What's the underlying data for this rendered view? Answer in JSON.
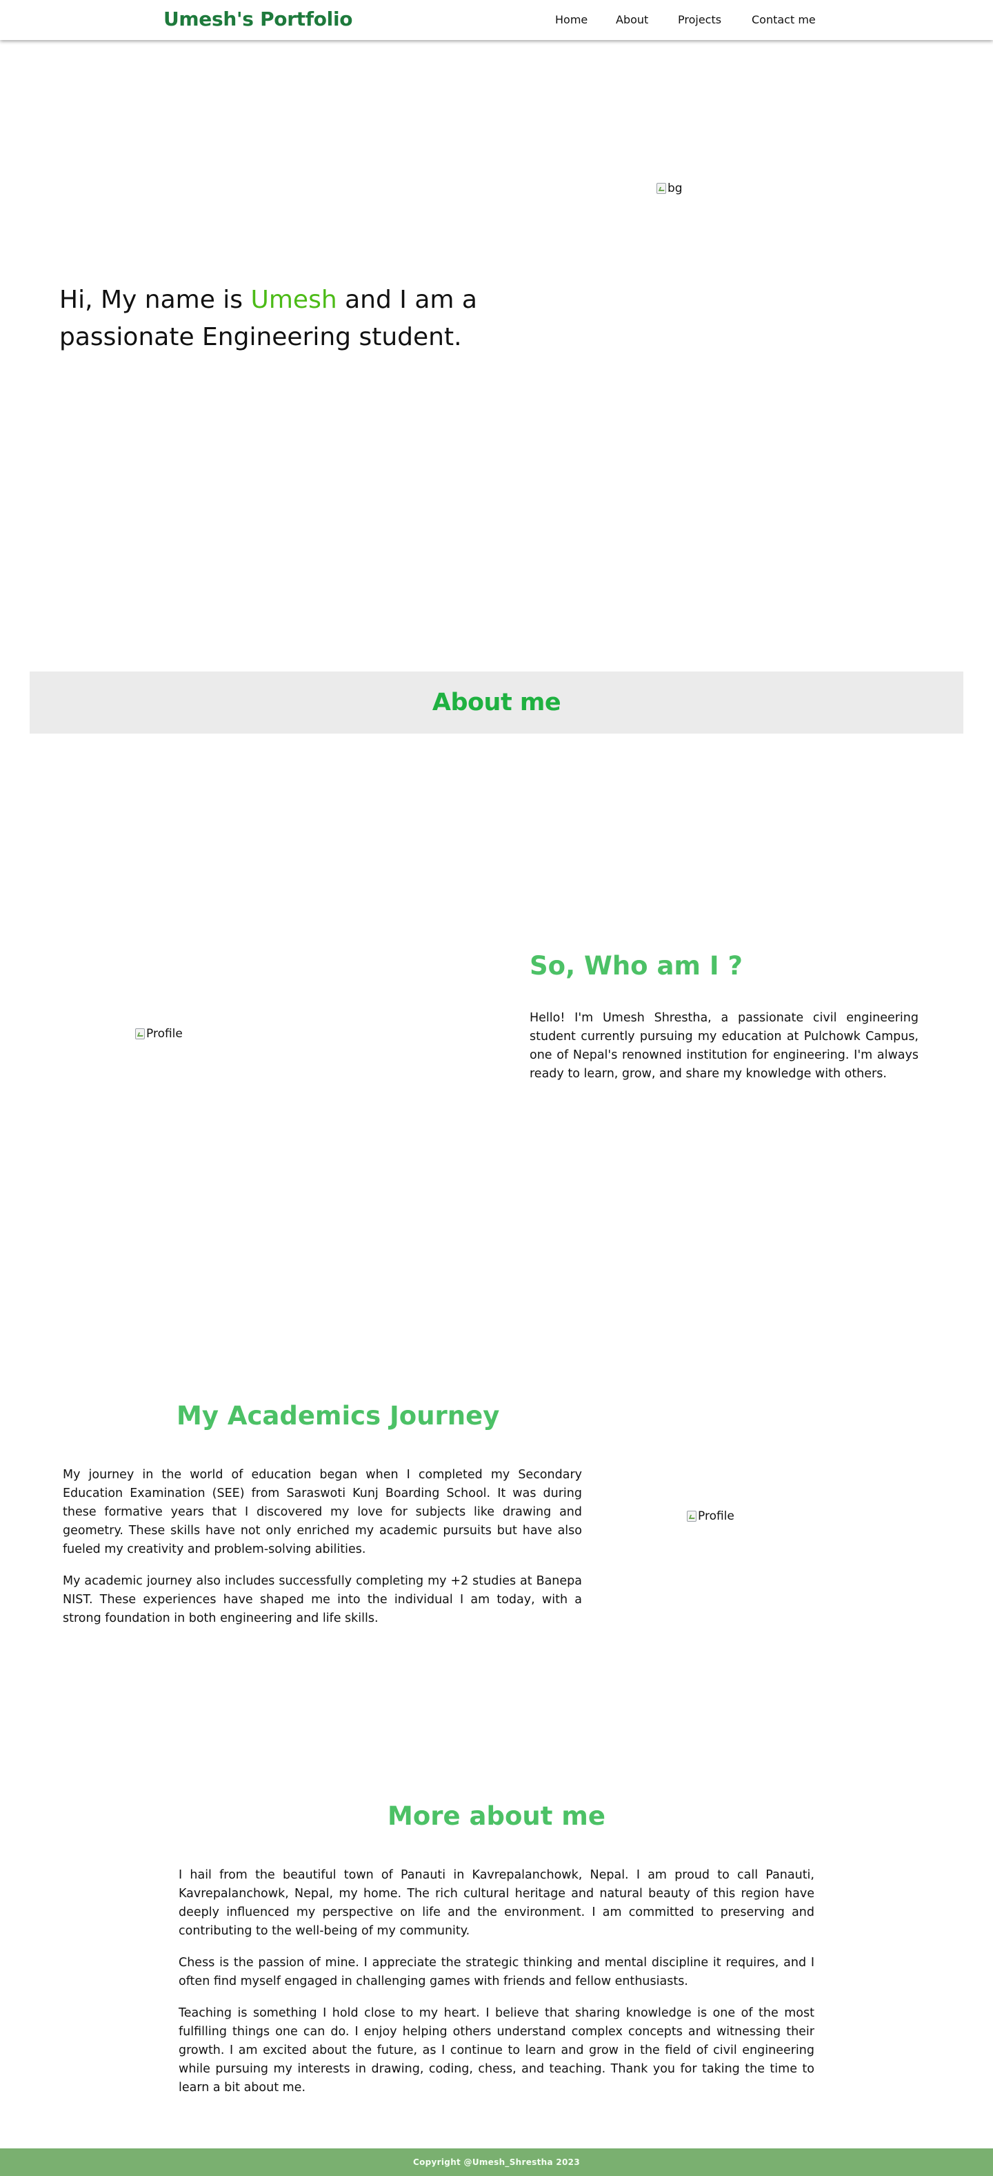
{
  "nav": {
    "brand": "Umesh's Portfolio",
    "links": [
      "Home",
      "About",
      "Projects",
      "Contact me"
    ]
  },
  "hero": {
    "text_before": "Hi, My name is ",
    "name": "Umesh",
    "text_after": " and I am a passionate Engineering student.",
    "image_alt": "bg"
  },
  "about": {
    "banner_title": "About me"
  },
  "whoami": {
    "image_alt": "Profile",
    "title": "So, Who am I ?",
    "text": "Hello! I'm Umesh Shrestha, a passionate civil engineering student currently pursuing my education at Pulchowk Campus, one of Nepal's renowned institution for engineering. I'm always ready to learn, grow, and share my knowledge with others."
  },
  "academics": {
    "title": "My Academics Journey",
    "paragraphs": [
      "My journey in the world of education began when I completed my Secondary Education Examination (SEE) from Saraswoti Kunj Boarding School. It was during these formative years that I discovered my love for subjects like drawing and geometry. These skills have not only enriched my academic pursuits but have also fueled my creativity and problem-solving abilities.",
      "My academic journey also includes successfully completing my +2 studies at Banepa NIST. These experiences have shaped me into the individual I am today, with a strong foundation in both engineering and life skills."
    ],
    "image_alt": "Profile"
  },
  "more": {
    "title": "More about me",
    "paragraphs": [
      "I hail from the beautiful town of Panauti in Kavrepalanchowk, Nepal. I am proud to call Panauti, Kavrepalanchowk, Nepal, my home. The rich cultural heritage and natural beauty of this region have deeply influenced my perspective on life and the environment. I am committed to preserving and contributing to the well-being of my community.",
      "Chess is the passion of mine. I appreciate the strategic thinking and mental discipline it requires, and I often find myself engaged in challenging games with friends and fellow enthusiasts.",
      "Teaching is something I hold close to my heart. I believe that sharing knowledge is one of the most fulfilling things one can do. I enjoy helping others understand complex concepts and witnessing their growth. I am excited about the future, as I continue to learn and grow in the field of civil engineering while pursuing my interests in drawing, coding, chess, and teaching. Thank you for taking the time to learn a bit about me."
    ]
  },
  "footer": {
    "copyright": "Copyright @Umesh_Shrestha 2023"
  },
  "colors": {
    "brand": "#1e7a3c",
    "accent": "#4cbb17",
    "heading": "#4cc166",
    "footer_bg": "#7ab070"
  }
}
